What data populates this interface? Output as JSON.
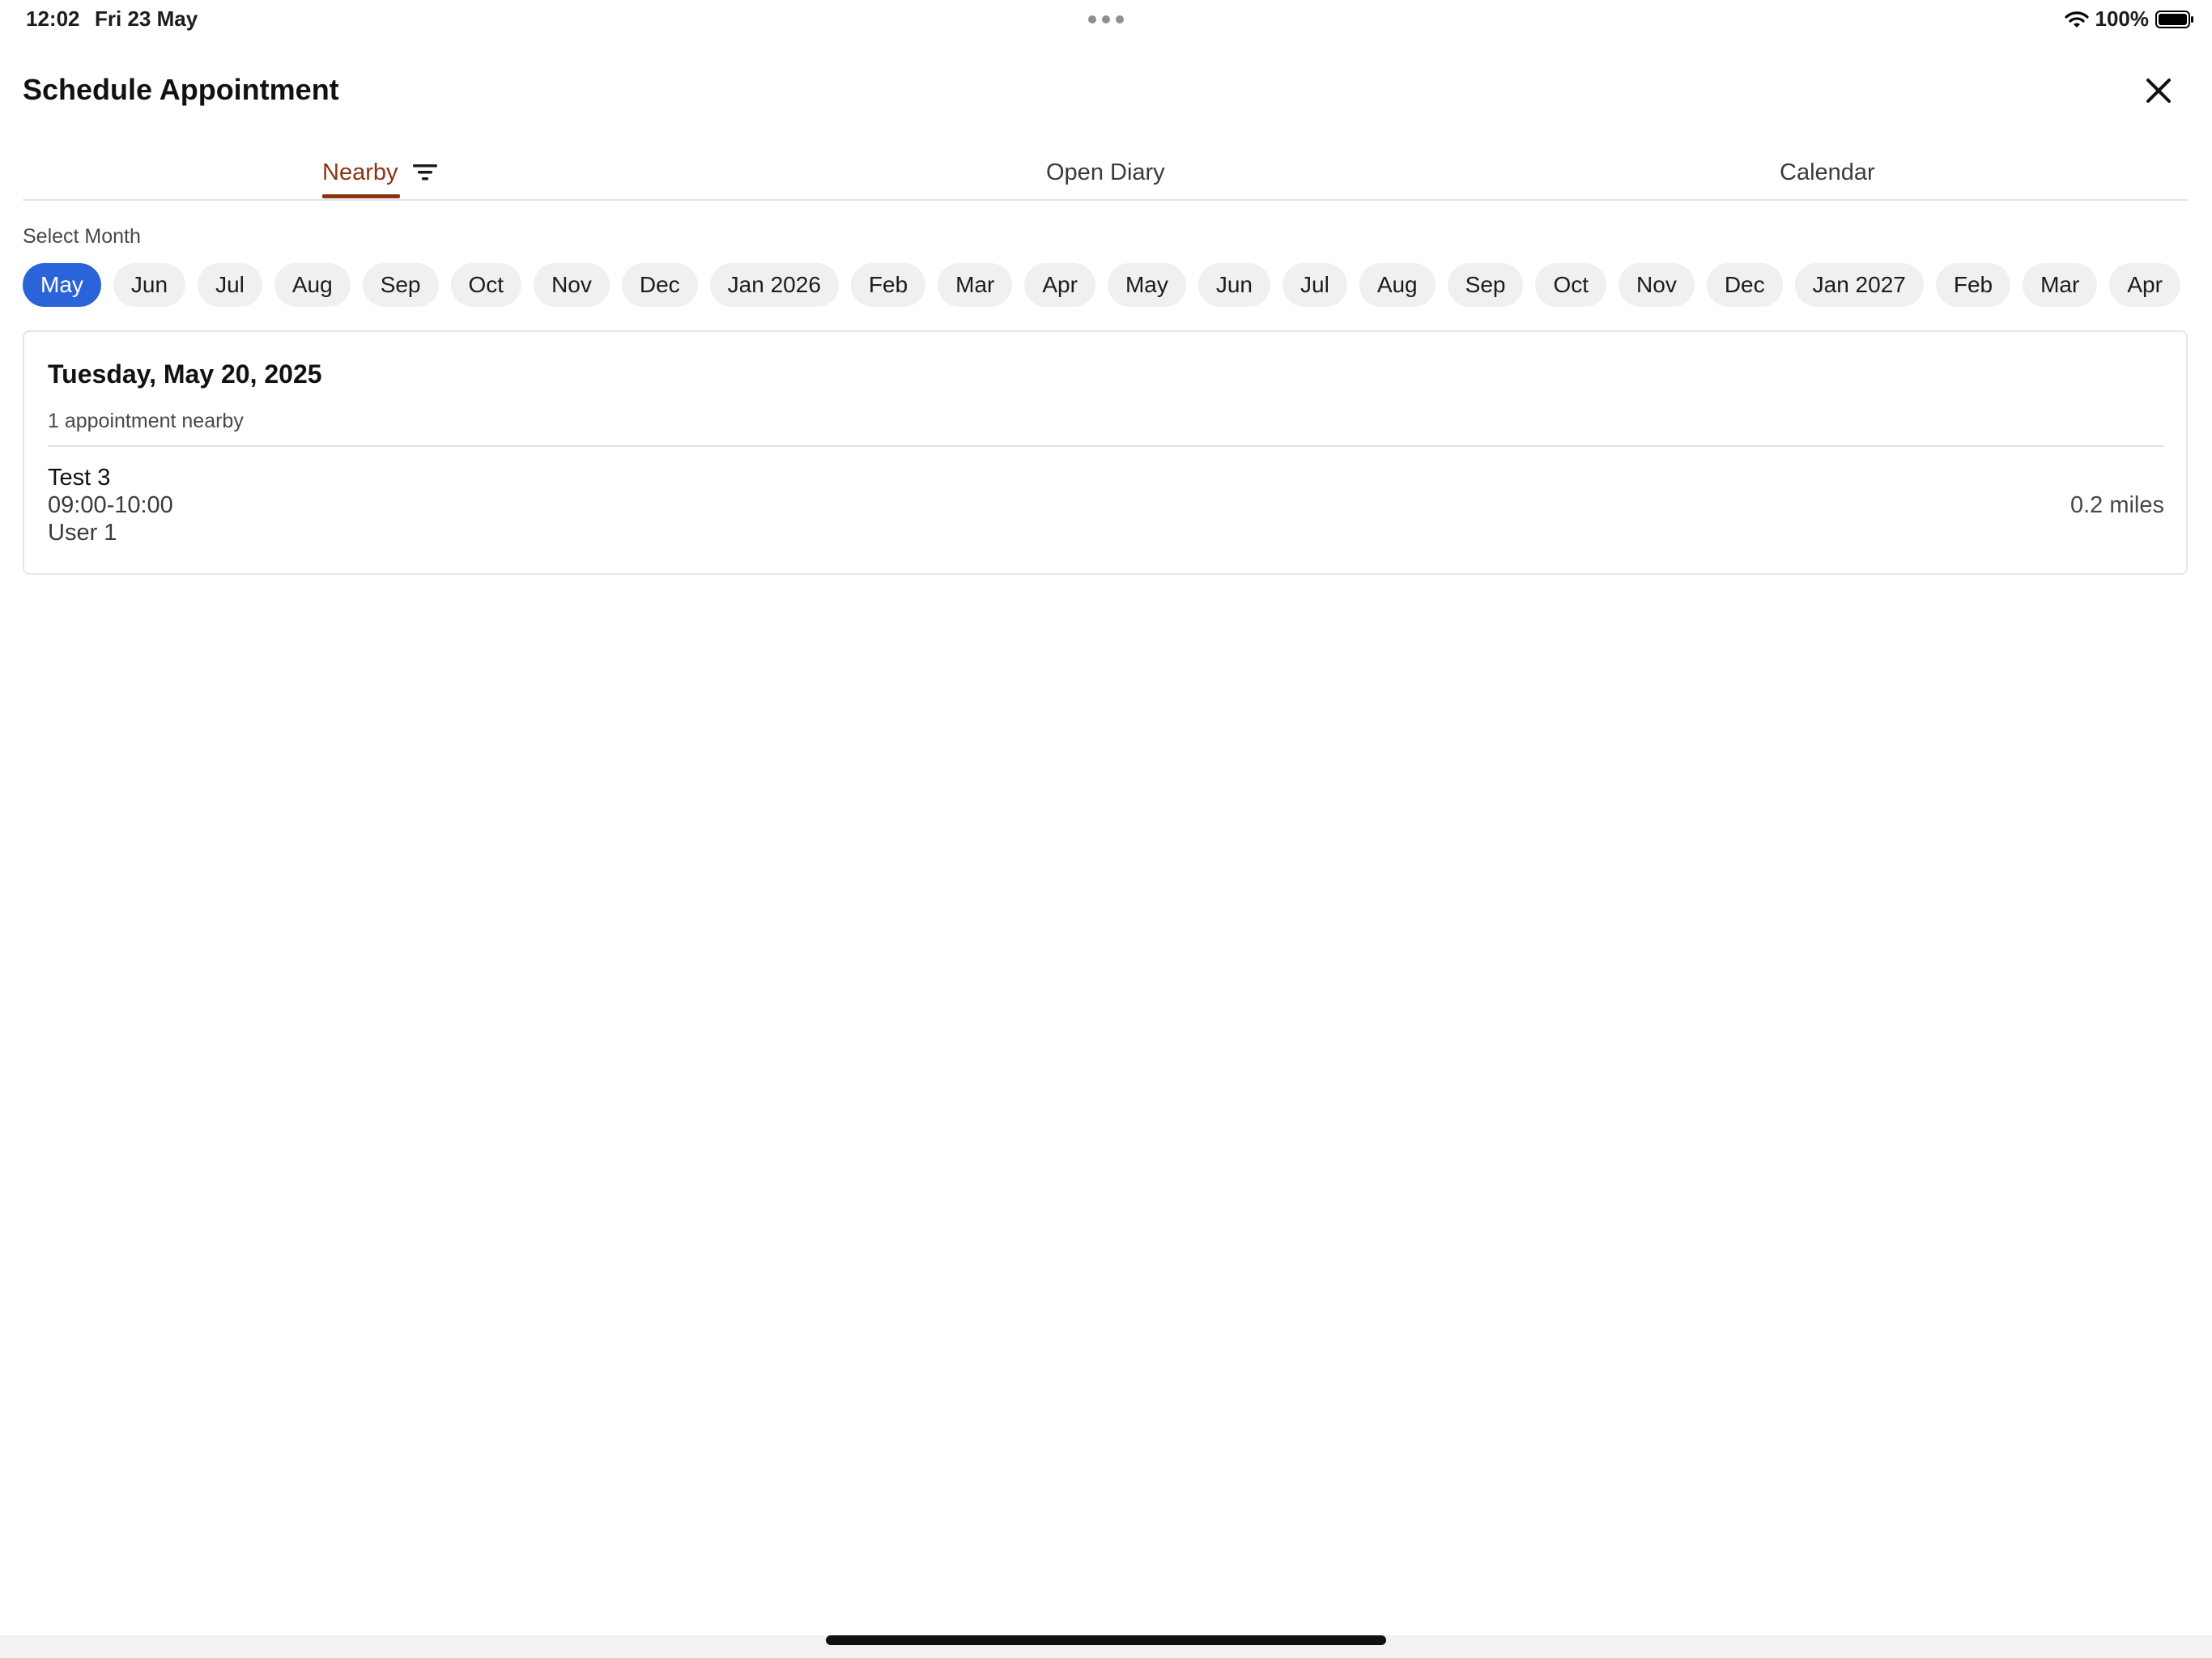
{
  "status_bar": {
    "time": "12:02",
    "date": "Fri 23 May",
    "battery": "100%"
  },
  "header": {
    "title": "Schedule Appointment",
    "close_icon": "close-icon"
  },
  "tabs": [
    {
      "label": "Nearby",
      "active": true,
      "icon": "filter-icon"
    },
    {
      "label": "Open Diary",
      "active": false
    },
    {
      "label": "Calendar",
      "active": false
    }
  ],
  "month_selector": {
    "label": "Select Month",
    "selected_index": 0,
    "months": [
      "May",
      "Jun",
      "Jul",
      "Aug",
      "Sep",
      "Oct",
      "Nov",
      "Dec",
      "Jan 2026",
      "Feb",
      "Mar",
      "Apr",
      "May",
      "Jun",
      "Jul",
      "Aug",
      "Sep",
      "Oct",
      "Nov",
      "Dec",
      "Jan 2027",
      "Feb",
      "Mar",
      "Apr",
      ""
    ]
  },
  "day_card": {
    "date": "Tuesday, May 20, 2025",
    "count_text": "1 appointment nearby",
    "appointments": [
      {
        "title": "Test 3",
        "time": "09:00-10:00",
        "user": "User 1",
        "distance": "0.2 miles"
      }
    ]
  },
  "colors": {
    "accent_tab": "#8a3412",
    "selected_chip": "#2b63d9",
    "chip_background": "#f0f0f2"
  }
}
